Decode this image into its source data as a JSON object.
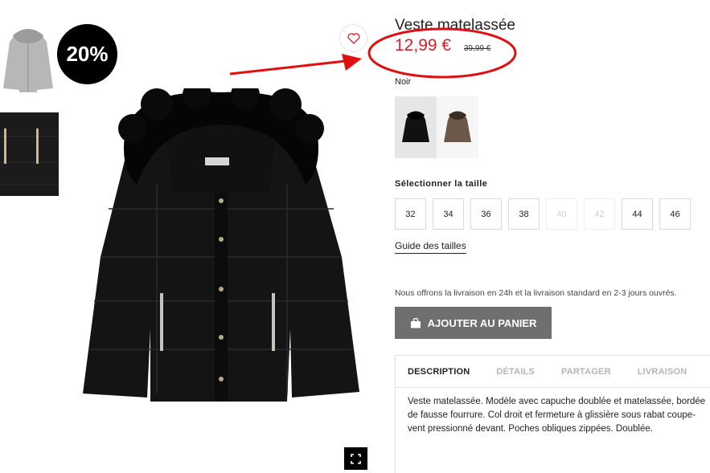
{
  "product": {
    "title": "Veste matelassée",
    "price": "12,99 €",
    "old_price": "39,99 €",
    "discount_badge": "20%",
    "color_name": "Noir",
    "swatches": [
      {
        "name": "noir",
        "color": "#111111"
      },
      {
        "name": "beige",
        "color": "#6b5848"
      }
    ]
  },
  "sizes": {
    "label": "Sélectionner la taille",
    "items": [
      {
        "label": "32",
        "available": true
      },
      {
        "label": "34",
        "available": true
      },
      {
        "label": "36",
        "available": true
      },
      {
        "label": "38",
        "available": true
      },
      {
        "label": "40",
        "available": false
      },
      {
        "label": "42",
        "available": false
      },
      {
        "label": "44",
        "available": true
      },
      {
        "label": "46",
        "available": true
      }
    ],
    "guide_label": "Guide des tailles"
  },
  "delivery_text": "Nous offrons la livraison en 24h et la livraison standard en 2-3 jours ouvrés.",
  "add_to_cart_label": "AJOUTER AU PANIER",
  "tabs": [
    {
      "label": "DESCRIPTION",
      "active": true
    },
    {
      "label": "DÉTAILS",
      "active": false
    },
    {
      "label": "PARTAGER",
      "active": false
    },
    {
      "label": "LIVRAISON",
      "active": false
    }
  ],
  "description": "Veste matelassée. Modèle avec capuche doublée et matelassée, bordée de fausse fourrure. Col droit et fermeture à glissière sous rabat coupe-vent pressionné devant. Poches obliques zippées. Doublée.",
  "colors": {
    "price_red": "#d1222d",
    "annotation_red": "#e01010",
    "button_gray": "#6f6f6f"
  },
  "icons": {
    "favorite": "heart-icon",
    "expand": "fullscreen-icon",
    "cart": "shopping-bag-icon"
  }
}
